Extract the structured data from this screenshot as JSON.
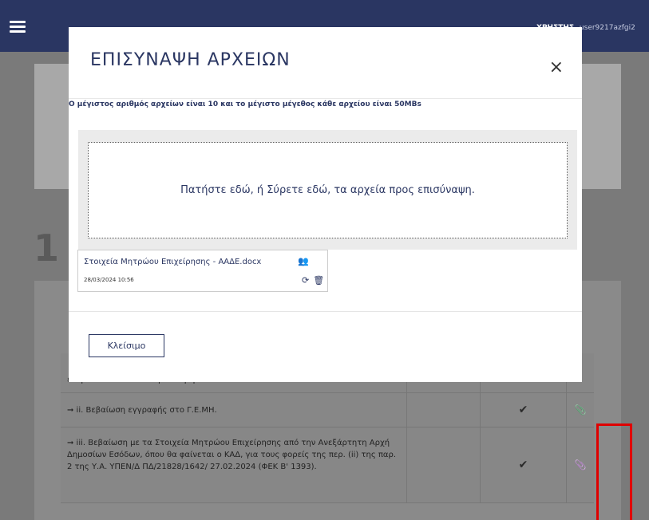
{
  "header": {
    "user_name": "ΧΡΗΣΤΗΣ",
    "user_id": "user9217azfgi2"
  },
  "background": {
    "step_number": "1",
    "rows": [
      {
        "text": "εκπροσωπο του οικονομικου φορεα",
        "check": "",
        "clip": ""
      },
      {
        "text": "➞ ii. Βεβαίωση εγγραφής στο Γ.Ε.ΜΗ.",
        "check": "✔",
        "clip": "📎"
      },
      {
        "text": "➞ iii. Βεβαίωση με τα Στοιχεία Μητρώου Επιχείρησης από την Ανεξάρτητη Αρχή Δημοσίων Εσόδων, όπου θα φαίνεται ο ΚΑΔ, για τους φορείς της περ. (ii) της παρ. 2 της Υ.Α. ΥΠΕΝ/Δ ΠΔ/21828/1642/ 27.02.2024 (ΦΕΚ Β' 1393).",
        "check": "✔",
        "clip": "📎"
      }
    ]
  },
  "modal": {
    "title": "ΕΠΙΣΥΝΑΨΗ ΑΡΧΕΙΩΝ",
    "close_icon": "×",
    "limit_text": "Ο μέγιστος αριθμός αρχείων είναι 10 και το μέγιστο μέγεθος κάθε αρχείου είναι 50MBs",
    "dropzone_text": "Πατήστε εδώ, ή Σύρετε εδώ, τα αρχεία προς επισύναψη.",
    "file": {
      "name": "Στοιχεία Μητρώου Επιχείρησης - ΑΑΔΕ.docx",
      "date": "28/03/2024 10:56",
      "users_icon": "👥",
      "refresh_icon": "⟳",
      "delete_icon": "🗑"
    },
    "close_button_label": "Κλείσιμο"
  },
  "colors": {
    "navbar": "#2a3662",
    "accent_text": "#2a3662",
    "highlight_box": "#e00000"
  }
}
